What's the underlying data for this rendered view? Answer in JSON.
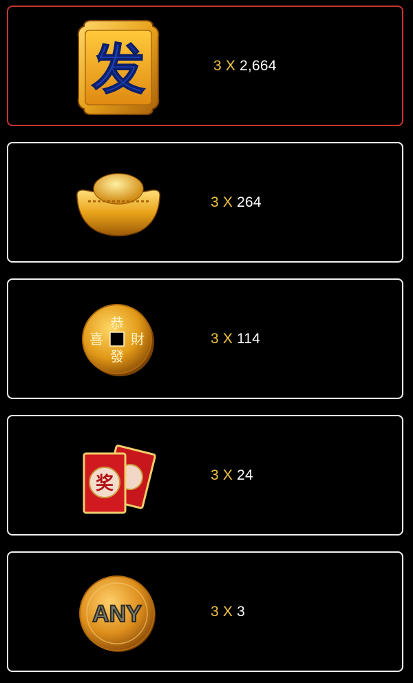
{
  "paytable": [
    {
      "symbol": "fa-tile-icon",
      "count": "3",
      "x_label": "X",
      "payout": "2,664",
      "selected": true
    },
    {
      "symbol": "gold-ingot-icon",
      "count": "3",
      "x_label": "X",
      "payout": "264",
      "selected": false
    },
    {
      "symbol": "gold-coin-icon",
      "count": "3",
      "x_label": "X",
      "payout": "114",
      "selected": false
    },
    {
      "symbol": "red-envelope-icon",
      "count": "3",
      "x_label": "X",
      "payout": "24",
      "selected": false
    },
    {
      "symbol": "any-coin-icon",
      "count": "3",
      "x_label": "X",
      "payout": "3",
      "selected": false
    }
  ],
  "symbol_text": {
    "fa": "发",
    "coin_top": "恭",
    "coin_left": "喜",
    "coin_right": "財",
    "coin_bottom": "發",
    "envelope": "奖",
    "any": "ANY"
  },
  "colors": {
    "selected_border": "#c8352f",
    "card_border": "#f2f2f2",
    "multiplier": "#f5c542",
    "payout_text": "#ffffff"
  }
}
